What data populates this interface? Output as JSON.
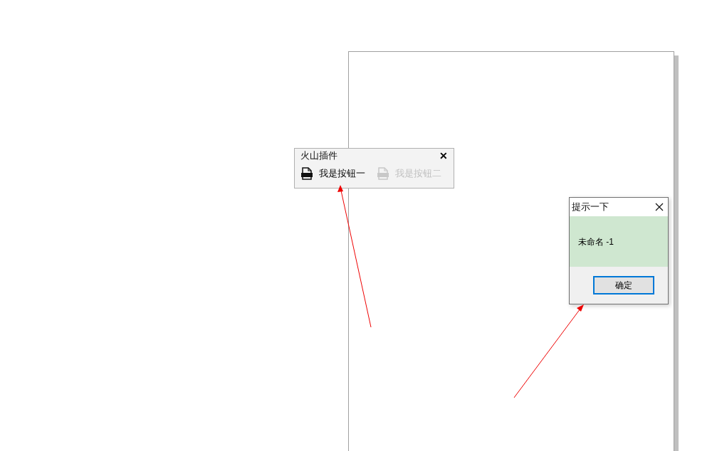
{
  "toolbar": {
    "title": "火山插件",
    "close": "✕",
    "buttons": [
      {
        "label": "我是按钮一",
        "disabled": false
      },
      {
        "label": "我是按钮二",
        "disabled": true
      }
    ]
  },
  "dialog": {
    "title": "提示一下",
    "message": "未命名 -1",
    "ok": "确定"
  }
}
